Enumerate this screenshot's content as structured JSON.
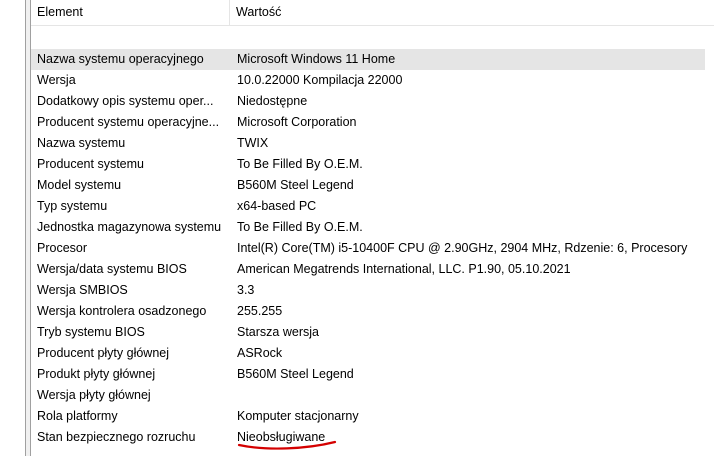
{
  "table": {
    "headers": {
      "element": "Element",
      "value": "Wartość"
    },
    "rows": [
      {
        "element": "Nazwa systemu operacyjnego",
        "value": "Microsoft Windows 11 Home"
      },
      {
        "element": "Wersja",
        "value": "10.0.22000 Kompilacja 22000"
      },
      {
        "element": "Dodatkowy opis systemu oper...",
        "value": "Niedostępne"
      },
      {
        "element": "Producent systemu operacyjne...",
        "value": "Microsoft Corporation"
      },
      {
        "element": "Nazwa systemu",
        "value": "TWIX"
      },
      {
        "element": "Producent systemu",
        "value": "To Be Filled By O.E.M."
      },
      {
        "element": "Model systemu",
        "value": "B560M Steel Legend"
      },
      {
        "element": "Typ systemu",
        "value": "x64-based PC"
      },
      {
        "element": "Jednostka magazynowa systemu",
        "value": "To Be Filled By O.E.M."
      },
      {
        "element": "Procesor",
        "value": "Intel(R) Core(TM) i5-10400F CPU @ 2.90GHz, 2904 MHz, Rdzenie: 6, Procesory"
      },
      {
        "element": "Wersja/data systemu BIOS",
        "value": "American Megatrends International, LLC. P1.90, 05.10.2021"
      },
      {
        "element": "Wersja SMBIOS",
        "value": "3.3"
      },
      {
        "element": "Wersja kontrolera osadzonego",
        "value": "255.255"
      },
      {
        "element": "Tryb systemu BIOS",
        "value": "Starsza wersja"
      },
      {
        "element": "Producent płyty głównej",
        "value": "ASRock"
      },
      {
        "element": "Produkt płyty głównej",
        "value": "B560M Steel Legend"
      },
      {
        "element": "Wersja płyty głównej",
        "value": ""
      },
      {
        "element": "Rola platformy",
        "value": "Komputer stacjonarny"
      },
      {
        "element": "Stan bezpiecznego rozruchu",
        "value": "Nieobsługiwane"
      }
    ]
  },
  "annotation_color": "#d40000",
  "selection_color": "#e5e5e5"
}
